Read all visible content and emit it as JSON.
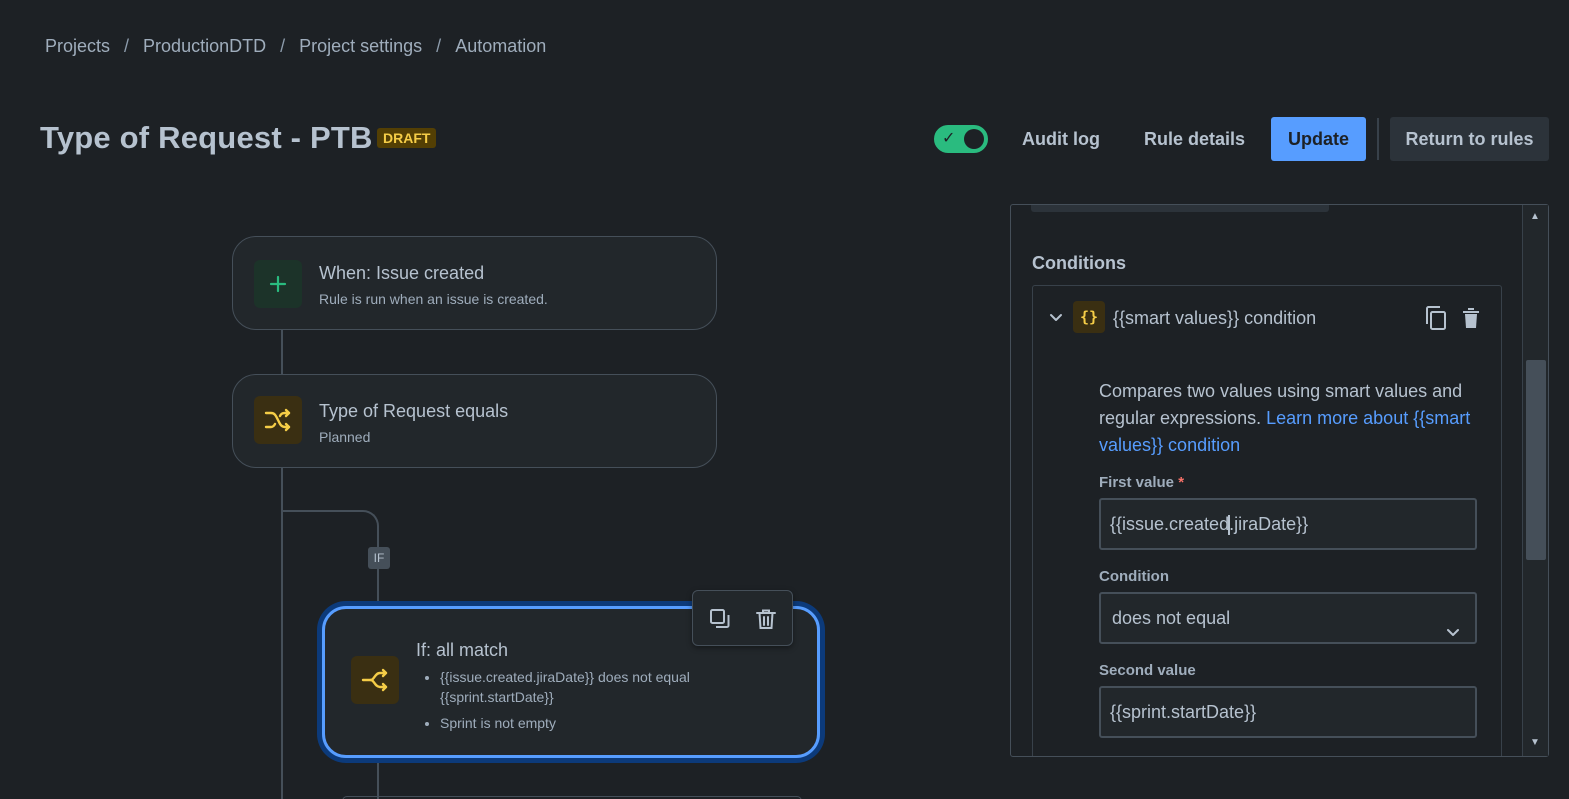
{
  "breadcrumb": [
    "Projects",
    "ProductionDTD",
    "Project settings",
    "Automation"
  ],
  "breadcrumb_sep": "/",
  "header": {
    "title": "Type of Request - PTB",
    "badge": "DRAFT",
    "rule_enabled": true,
    "audit_log": "Audit log",
    "rule_details": "Rule details",
    "update": "Update",
    "return_to_rules": "Return to rules"
  },
  "flow": {
    "trigger": {
      "title": "When: Issue created",
      "subtitle": "Rule is run when an issue is created.",
      "icon": "plus-icon"
    },
    "condition": {
      "title": "Type of Request equals",
      "subtitle": "Planned",
      "icon": "shuffle-icon"
    },
    "branch_tag": "IF",
    "if_block": {
      "title": "If: all match",
      "items": [
        "{{issue.created.jiraDate}} does not equal {{sprint.startDate}}",
        "Sprint is not empty"
      ],
      "icon": "branch-icon"
    }
  },
  "panel": {
    "section_title": "Conditions",
    "condition": {
      "title": "{{smart values}} condition",
      "icon_text": "{}",
      "description": "Compares two values using smart values and regular expressions.",
      "learn_more": "Learn more about {{smart values}} condition",
      "first_value_label": "First value",
      "required_mark": "*",
      "first_value_before": "{{issue.created",
      "first_value_after": ".jiraDate}}",
      "condition_label": "Condition",
      "condition_value": "does not equal",
      "second_value_label": "Second value",
      "second_value": "{{sprint.startDate}}"
    }
  },
  "colors": {
    "background": "#1d2125",
    "accent": "#579dff",
    "toggle_on": "#2abb7f",
    "draft_badge": "#533f04",
    "condition_icon": "#f5cd47"
  }
}
